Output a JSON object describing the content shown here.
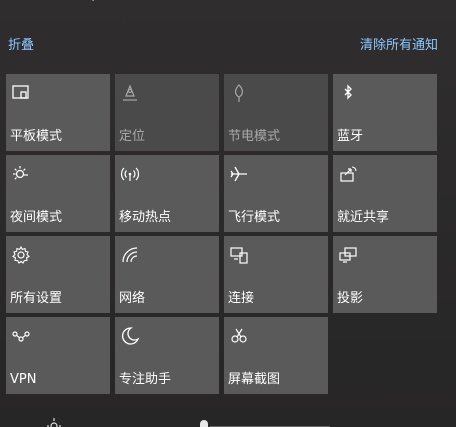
{
  "header": {
    "collapse_label": "折叠",
    "clear_all_label": "清除所有通知"
  },
  "tiles": [
    {
      "label": "平板模式",
      "icon": "tablet-mode-icon",
      "enabled": true
    },
    {
      "label": "定位",
      "icon": "location-icon",
      "enabled": false
    },
    {
      "label": "节电模式",
      "icon": "battery-saver-icon",
      "enabled": false
    },
    {
      "label": "蓝牙",
      "icon": "bluetooth-icon",
      "enabled": true
    },
    {
      "label": "夜间模式",
      "icon": "night-light-icon",
      "enabled": true
    },
    {
      "label": "移动热点",
      "icon": "mobile-hotspot-icon",
      "enabled": true
    },
    {
      "label": "飞行模式",
      "icon": "airplane-icon",
      "enabled": true
    },
    {
      "label": "就近共享",
      "icon": "nearby-share-icon",
      "enabled": true
    },
    {
      "label": "所有设置",
      "icon": "settings-gear-icon",
      "enabled": true
    },
    {
      "label": "网络",
      "icon": "network-icon",
      "enabled": true
    },
    {
      "label": "连接",
      "icon": "connect-icon",
      "enabled": true
    },
    {
      "label": "投影",
      "icon": "project-icon",
      "enabled": true
    },
    {
      "label": "VPN",
      "icon": "vpn-icon",
      "enabled": true
    },
    {
      "label": "专注助手",
      "icon": "focus-assist-moon-icon",
      "enabled": true
    },
    {
      "label": "屏幕截图",
      "icon": "screen-snip-icon",
      "enabled": true
    }
  ],
  "colors": {
    "tile_bg": "#5a5a5a",
    "tile_disabled_bg": "#4a4a4a",
    "link": "#8cc8ff"
  }
}
